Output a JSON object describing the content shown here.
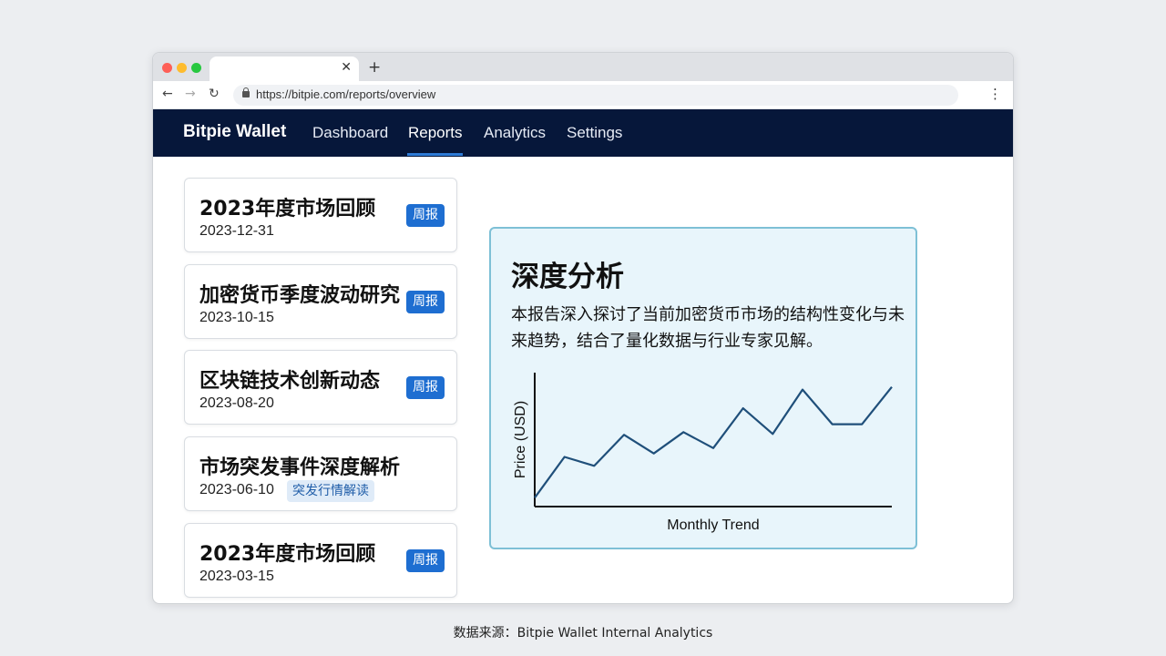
{
  "browser": {
    "url": "https://bitpie.com/reports/overview",
    "traffic_lights": [
      "#fe5f57",
      "#febc2e",
      "#28c840"
    ]
  },
  "nav": {
    "brand": "Bitpie Wallet",
    "items": [
      {
        "label": "Dashboard"
      },
      {
        "label": "Reports"
      },
      {
        "label": "Analytics"
      },
      {
        "label": "Settings"
      }
    ],
    "active": "Reports"
  },
  "reports": [
    {
      "title": "2023年度市场回顾",
      "date": "2023-12-31",
      "badge": "周报"
    },
    {
      "title": "加密货币季度波动研究",
      "date": "2023-10-15",
      "badge": "周报"
    },
    {
      "title": "区块链技术创新动态",
      "date": "2023-08-20",
      "badge": "周报"
    },
    {
      "title": "市场突发事件深度解析",
      "date": "2023-06-10",
      "badge": "突发行情解读"
    },
    {
      "title": "2023年度市场回顾",
      "date": "2023-03-15",
      "badge": "周报"
    }
  ],
  "detail": {
    "title": "深度分析",
    "body": "本报告深入探讨了当前加密货币市场的结构性变化与未来趋势，结合了量化数据与行业专家见解。"
  },
  "chart_data": {
    "type": "line",
    "title": "",
    "xlabel": "Monthly Trend",
    "ylabel": "Price (USD)",
    "x": [
      1,
      2,
      3,
      4,
      5,
      6,
      7,
      8,
      9,
      10,
      11,
      12,
      13
    ],
    "values": [
      10,
      56,
      46,
      81,
      60,
      84,
      66,
      111,
      82,
      132,
      93,
      93,
      135
    ],
    "ylim": [
      0,
      145
    ],
    "grid": false,
    "line_color": "#1f4f7a"
  },
  "footer": {
    "source": "数据来源：Bitpie Wallet Internal Analytics"
  }
}
